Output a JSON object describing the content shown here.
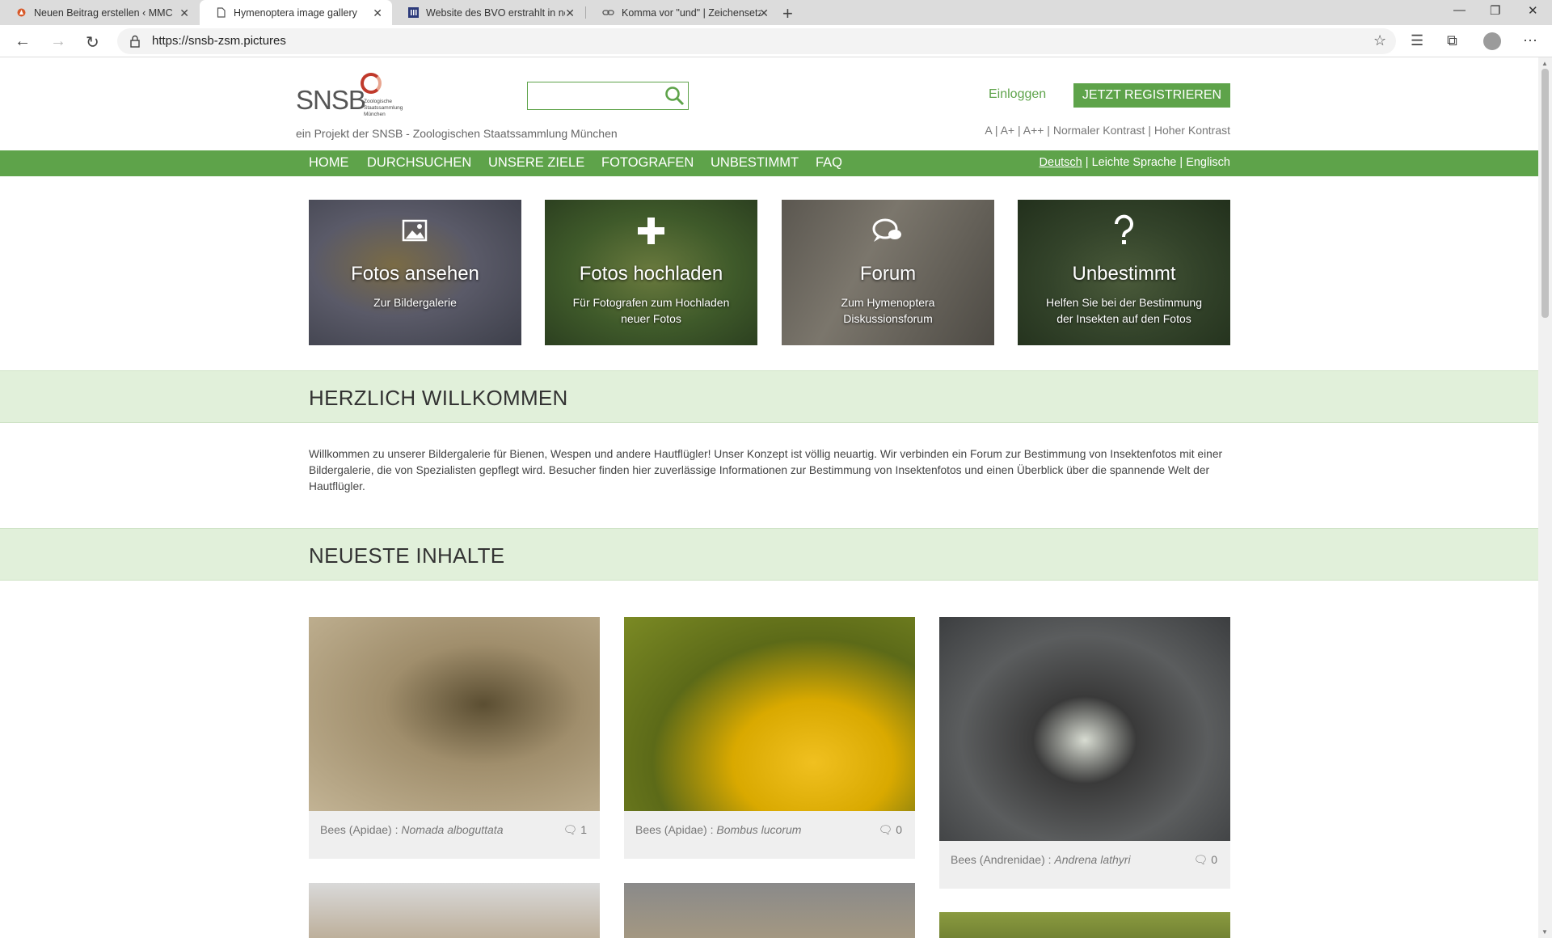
{
  "browser": {
    "tabs": [
      {
        "title": "Neuen Beitrag erstellen ‹ MMC A"
      },
      {
        "title": "Hymenoptera image gallery"
      },
      {
        "title": "Website des BVO erstrahlt in ne"
      },
      {
        "title": "Komma vor \"und\" | Zeichensetzu"
      }
    ],
    "url": "https://snsb-zsm.pictures"
  },
  "site": {
    "logo_text": "SNSB",
    "logo_sub": "Zoologische Staatssammlung München",
    "tagline": "ein Projekt der SNSB - Zoologischen Staatssammlung München",
    "login": "Einloggen",
    "register": "JETZT REGISTRIEREN",
    "a11y": "A | A+ | A++ | Normaler Kontrast | Hoher Kontrast",
    "nav": [
      "HOME",
      "DURCHSUCHEN",
      "UNSERE ZIELE",
      "FOTOGRAFEN",
      "UNBESTIMMT",
      "FAQ"
    ],
    "lang": {
      "current": "Deutsch",
      "rest": " | Leichte Sprache | Englisch"
    },
    "accent": "#5ea34a"
  },
  "tiles": [
    {
      "title": "Fotos ansehen",
      "sub": "Zur Bildergalerie",
      "icon": "image-icon"
    },
    {
      "title": "Fotos hochladen",
      "sub": "Für Fotografen zum Hochladen neuer Fotos",
      "icon": "plus-icon"
    },
    {
      "title": "Forum",
      "sub": "Zum Hymenoptera Diskussionsforum",
      "icon": "chat-icon"
    },
    {
      "title": "Unbestimmt",
      "sub": "Helfen Sie bei der Bestimmung der Insekten auf den Fotos",
      "icon": "question-icon"
    }
  ],
  "welcome": {
    "heading": "HERZLICH WILLKOMMEN",
    "text": "Willkommen zu unserer Bildergalerie für Bienen, Wespen und andere Hautflügler! Unser Konzept ist völlig neuartig. Wir verbinden ein Forum zur Bestimmung von Insektenfotos mit einer Bildergalerie, die von Spezialisten gepflegt wird. Besucher finden hier zuverlässige Informationen zur Bestimmung von Insektenfotos und einen Überblick über die spannende Welt der Hautflügler."
  },
  "latest": {
    "heading": "NEUESTE INHALTE",
    "cards": [
      {
        "family": "Bees (Apidae) : ",
        "species": "Nomada alboguttata",
        "comments": "1"
      },
      {
        "family": "Bees (Apidae) : ",
        "species": "Bombus lucorum",
        "comments": "0"
      },
      {
        "family": "Bees (Andrenidae) : ",
        "species": "Andrena lathyri",
        "comments": "0"
      }
    ]
  }
}
